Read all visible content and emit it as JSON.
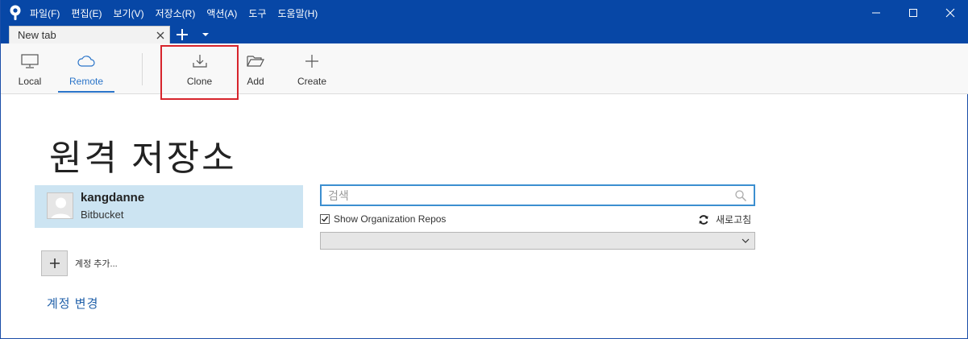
{
  "menu": [
    "파일(F)",
    "편집(E)",
    "보기(V)",
    "저장소(R)",
    "액션(A)",
    "도구",
    "도움말(H)"
  ],
  "tabs": [
    {
      "label": "New tab"
    }
  ],
  "toolbar": {
    "local": "Local",
    "remote": "Remote",
    "clone": "Clone",
    "add": "Add",
    "create": "Create"
  },
  "main": {
    "title": "원격 저장소",
    "account": {
      "name": "kangdanne",
      "service": "Bitbucket"
    },
    "add_account_label": "계정 추가...",
    "change_account_label": "계정 변경",
    "search": {
      "placeholder": "검색",
      "value": ""
    },
    "show_org_repos": {
      "label": "Show Organization Repos",
      "checked": true
    },
    "refresh_label": "새로고침",
    "dropdown_value": ""
  },
  "colors": {
    "titlebar": "#0747a6",
    "accent": "#2a74c9",
    "selected_account": "#cce4f2",
    "highlight": "#d7242c"
  },
  "icons": {
    "logo": "sourcetree-logo",
    "local": "monitor-icon",
    "remote": "cloud-icon",
    "clone": "download-icon",
    "add": "folder-open-icon",
    "create": "plus-icon",
    "search": "search-icon",
    "refresh": "refresh-icon"
  }
}
